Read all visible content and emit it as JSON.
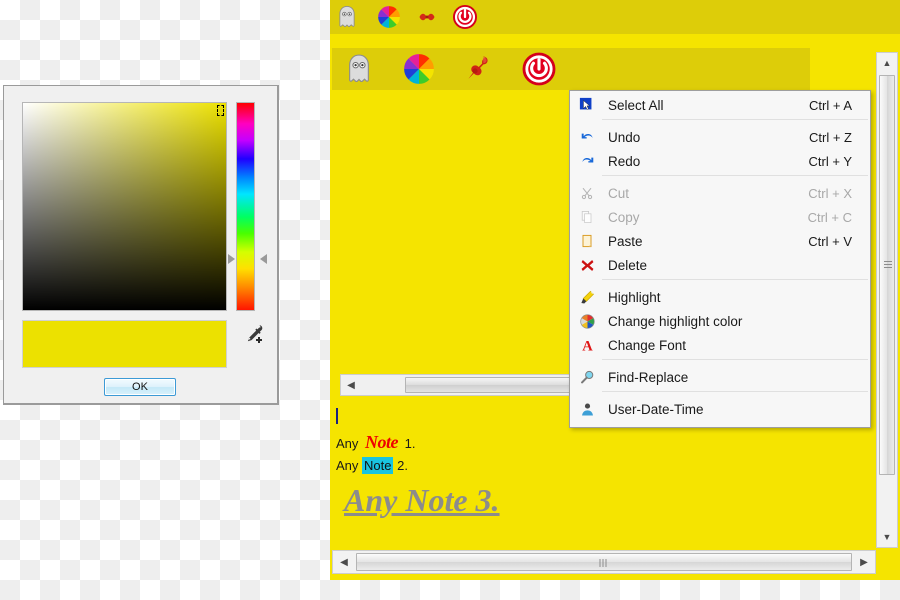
{
  "color_dialog": {
    "name": "Color picker dialog",
    "selected_color": "#ece100",
    "swatch_color": "#ece100",
    "ok_label": "OK",
    "eyedropper_icon": "eyedropper-icon",
    "hue_marker_icon": "triangle-marker-icon"
  },
  "note_window": {
    "background_color": "#f5e400",
    "toolbar_color": "#ddcd09",
    "mini_toolbar": {
      "items": [
        {
          "icon": "ghost-icon",
          "label": "Ghost"
        },
        {
          "icon": "color-wheel-icon",
          "label": "Color wheel"
        },
        {
          "icon": "pushpin-icon",
          "label": "Pin"
        },
        {
          "icon": "power-icon",
          "label": "Power"
        }
      ]
    },
    "main_toolbar": {
      "items": [
        {
          "icon": "ghost-icon",
          "label": "Ghost"
        },
        {
          "icon": "color-wheel-icon",
          "label": "Color wheel"
        },
        {
          "icon": "pushpin-icon",
          "label": "Pin"
        },
        {
          "icon": "power-icon",
          "label": "Power"
        }
      ]
    },
    "notes": [
      {
        "prefix": "Any ",
        "emphasis": "Note",
        "suffix": " 1.",
        "style": "red-script"
      },
      {
        "prefix": "Any ",
        "emphasis": "Note",
        "suffix": " 2.",
        "style": "cyan-highlight"
      },
      {
        "text": "Any Note 3.",
        "style": "gray-italic-underline"
      }
    ],
    "scrollbars": {
      "left_arrow": "◀",
      "right_arrow": "▶",
      "up_arrow": "▲",
      "down_arrow": "▼"
    }
  },
  "context_menu": {
    "items": [
      {
        "icon": "select-all-icon",
        "label": "Select All",
        "accel": "Ctrl + A",
        "disabled": false,
        "divider_after": true
      },
      {
        "icon": "undo-icon",
        "label": "Undo",
        "accel": "Ctrl + Z",
        "disabled": false,
        "divider_after": false
      },
      {
        "icon": "redo-icon",
        "label": "Redo",
        "accel": "Ctrl + Y",
        "disabled": false,
        "divider_after": true
      },
      {
        "icon": "scissors-icon",
        "label": "Cut",
        "accel": "Ctrl + X",
        "disabled": true,
        "divider_after": false
      },
      {
        "icon": "copy-icon",
        "label": "Copy",
        "accel": "Ctrl + C",
        "disabled": true,
        "divider_after": false
      },
      {
        "icon": "paste-icon",
        "label": "Paste",
        "accel": "Ctrl + V",
        "disabled": false,
        "divider_after": false
      },
      {
        "icon": "delete-icon",
        "label": "Delete",
        "accel": "",
        "disabled": false,
        "divider_after": true
      },
      {
        "icon": "highlighter-icon",
        "label": "Highlight",
        "accel": "",
        "disabled": false,
        "divider_after": false
      },
      {
        "icon": "color-wheel-icon",
        "label": "Change highlight color",
        "accel": "",
        "disabled": false,
        "divider_after": false
      },
      {
        "icon": "font-a-icon",
        "label": "Change Font",
        "accel": "",
        "disabled": false,
        "divider_after": true
      },
      {
        "icon": "magnifier-icon",
        "label": "Find-Replace",
        "accel": "",
        "disabled": false,
        "divider_after": true
      },
      {
        "icon": "user-icon",
        "label": "User-Date-Time",
        "accel": "",
        "disabled": false,
        "divider_after": false
      }
    ]
  }
}
